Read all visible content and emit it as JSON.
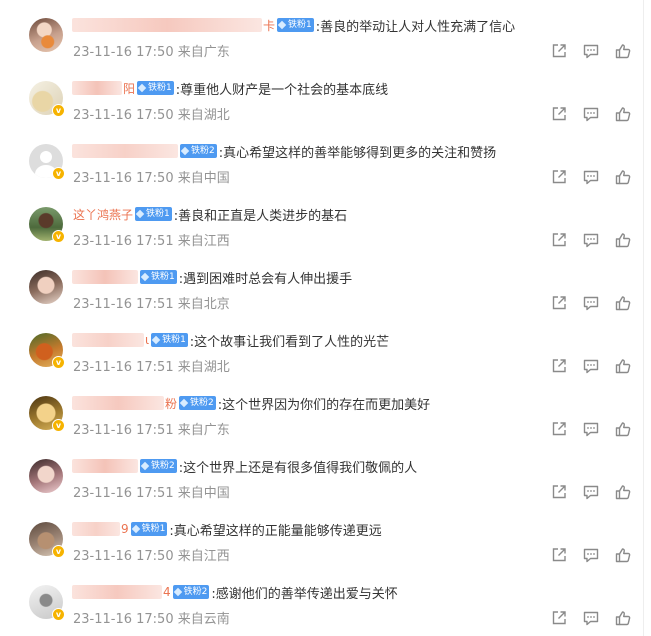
{
  "colors": {
    "meta": "#939393",
    "text": "#333333",
    "fan_badge": "#4e9af1",
    "name_orange": "#eb7350",
    "vip_badge": "#f6b300"
  },
  "comments": [
    {
      "name_visible": "卡",
      "name_blur_width": 190,
      "badge": "铁粉1",
      "text": ":善良的举动让人对人性充满了信心",
      "time": "23-11-16 17:50",
      "location": "来自广东",
      "avatar": "photo-girl-flowers",
      "verified": false
    },
    {
      "name_visible": "阳",
      "name_blur_width": 50,
      "badge": "铁粉1",
      "text": ":尊重他人财产是一个社会的基本底线",
      "time": "23-11-16 17:50",
      "location": "来自湖北",
      "avatar": "photo-light",
      "verified": true
    },
    {
      "name_visible": "",
      "name_blur_width": 106,
      "badge": "铁粉2",
      "text": ":真心希望这样的善举能够得到更多的关注和赞扬",
      "time": "23-11-16 17:50",
      "location": "来自中国",
      "avatar": "default-gray",
      "verified": true
    },
    {
      "name_visible": "这丫鸿燕子",
      "name_blur_width": 0,
      "badge": "铁粉1",
      "text": ":善良和正直是人类进步的基石",
      "time": "23-11-16 17:51",
      "location": "来自江西",
      "avatar": "photo-outdoor",
      "verified": true
    },
    {
      "name_visible": "",
      "name_blur_width": 66,
      "badge": "铁粉1",
      "text": ":遇到困难时总会有人伸出援手",
      "time": "23-11-16 17:51",
      "location": "来自北京",
      "avatar": "photo-girl",
      "verified": false
    },
    {
      "name_visible": "ι",
      "name_blur_width": 72,
      "badge": "铁粉1",
      "text": ":这个故事让我们看到了人性的光芒",
      "time": "23-11-16 17:51",
      "location": "来自湖北",
      "avatar": "photo-food",
      "verified": true
    },
    {
      "name_visible": "粉",
      "name_blur_width": 92,
      "badge": "铁粉2",
      "text": ":这个世界因为你们的存在而更加美好",
      "time": "23-11-16 17:51",
      "location": "来自广东",
      "avatar": "photo-golden",
      "verified": true
    },
    {
      "name_visible": "",
      "name_blur_width": 66,
      "badge": "铁粉2",
      "text": ":这个世界上还是有很多值得我们敬佩的人",
      "time": "23-11-16 17:51",
      "location": "来自中国",
      "avatar": "photo-girl-2",
      "verified": false
    },
    {
      "name_visible": "9",
      "name_blur_width": 48,
      "badge": "铁粉1",
      "text": ":真心希望这样的正能量能够传递更远",
      "time": "23-11-16 17:50",
      "location": "来自江西",
      "avatar": "photo-room",
      "verified": true
    },
    {
      "name_visible": "4",
      "name_blur_width": 90,
      "badge": "铁粉2",
      "text": ":感谢他们的善举传递出爱与关怀",
      "time": "23-11-16 17:50",
      "location": "来自云南",
      "avatar": "photo-figure",
      "verified": true
    }
  ],
  "icons": {
    "share": "share-icon",
    "comment": "comment-icon",
    "like": "like-icon"
  }
}
